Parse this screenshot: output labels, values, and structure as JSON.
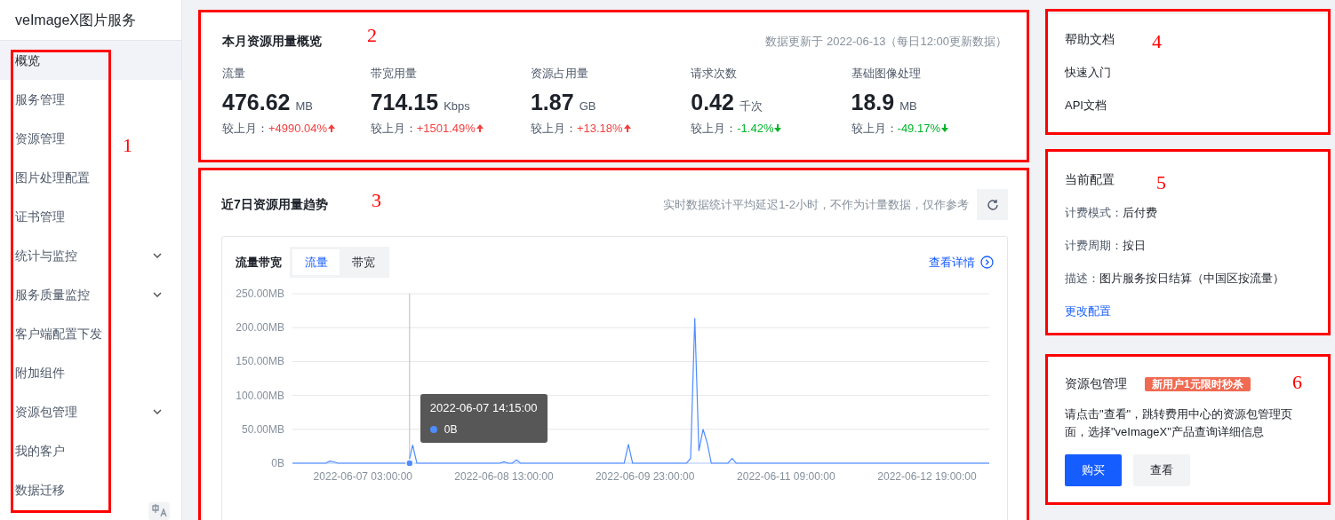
{
  "sidebar": {
    "title": "veImageX图片服务",
    "annotation": "1",
    "items": [
      {
        "label": "概览",
        "selected": true,
        "expandable": false
      },
      {
        "label": "服务管理",
        "selected": false,
        "expandable": false
      },
      {
        "label": "资源管理",
        "selected": false,
        "expandable": false
      },
      {
        "label": "图片处理配置",
        "selected": false,
        "expandable": false
      },
      {
        "label": "证书管理",
        "selected": false,
        "expandable": false
      },
      {
        "label": "统计与监控",
        "selected": false,
        "expandable": true
      },
      {
        "label": "服务质量监控",
        "selected": false,
        "expandable": true
      },
      {
        "label": "客户端配置下发",
        "selected": false,
        "expandable": false
      },
      {
        "label": "附加组件",
        "selected": false,
        "expandable": false
      },
      {
        "label": "资源包管理",
        "selected": false,
        "expandable": true
      },
      {
        "label": "我的客户",
        "selected": false,
        "expandable": false
      },
      {
        "label": "数据迁移",
        "selected": false,
        "expandable": false
      }
    ]
  },
  "overview": {
    "title": "本月资源用量概览",
    "annotation": "2",
    "update_note": "数据更新于 2022-06-13（每日12:00更新数据）",
    "metrics": [
      {
        "label": "流量",
        "value": "476.62",
        "unit": "MB",
        "change_label": "较上月：",
        "change": "+4990.04%",
        "increase": true
      },
      {
        "label": "带宽用量",
        "value": "714.15",
        "unit": "Kbps",
        "change_label": "较上月：",
        "change": "+1501.49%",
        "increase": true
      },
      {
        "label": "资源占用量",
        "value": "1.87",
        "unit": "GB",
        "change_label": "较上月：",
        "change": "+13.18%",
        "increase": true
      },
      {
        "label": "请求次数",
        "value": "0.42",
        "unit": "千次",
        "change_label": "较上月：",
        "change": "-1.42%",
        "increase": false
      },
      {
        "label": "基础图像处理",
        "value": "18.9",
        "unit": "MB",
        "change_label": "较上月：",
        "change": "-49.17%",
        "increase": false
      }
    ]
  },
  "trend": {
    "title": "近7日资源用量趋势",
    "annotation": "3",
    "note": "实时数据统计平均延迟1-2小时，不作为计量数据，仅作参考",
    "card": {
      "title": "流量带宽",
      "tabs": [
        {
          "label": "流量",
          "selected": true
        },
        {
          "label": "带宽",
          "selected": false
        }
      ],
      "link": "查看详情",
      "tooltip": {
        "time": "2022-06-07 14:15:00",
        "value": "0B"
      },
      "chart_data": {
        "type": "line",
        "grid": true,
        "ylim": [
          0,
          250
        ],
        "categories": [
          null,
          null,
          null,
          null,
          null,
          null,
          null,
          null,
          null,
          null,
          null,
          null,
          null,
          null,
          null,
          null,
          null,
          "2022-06-07 03:00:00",
          null,
          null,
          null,
          null,
          null,
          null,
          null,
          null,
          null,
          null,
          null,
          null,
          null,
          null,
          null,
          null,
          null,
          null,
          null,
          null,
          null,
          null,
          null,
          null,
          null,
          null,
          null,
          null,
          null,
          null,
          null,
          null,
          null,
          "2022-06-08 13:00:00",
          null,
          null,
          null,
          null,
          null,
          null,
          null,
          null,
          null,
          null,
          null,
          null,
          null,
          null,
          null,
          null,
          null,
          null,
          null,
          null,
          null,
          null,
          null,
          null,
          null,
          null,
          null,
          null,
          null,
          null,
          null,
          null,
          null,
          "2022-06-09 23:00:00",
          null,
          null,
          null,
          null,
          null,
          null,
          null,
          null,
          null,
          null,
          null,
          null,
          null,
          null,
          null,
          null,
          null,
          null,
          null,
          null,
          null,
          null,
          null,
          null,
          null,
          null,
          null,
          null,
          null,
          null,
          null,
          null,
          null,
          "2022-06-11 09:00:00",
          null,
          null,
          null,
          null,
          null,
          null,
          null,
          null,
          null,
          null,
          null,
          null,
          null,
          null,
          null,
          null,
          null,
          null,
          null,
          null,
          null,
          null,
          null,
          null,
          null,
          null,
          null,
          null,
          null,
          null,
          null,
          null,
          null,
          "2022-06-12 19:00:00",
          null,
          null,
          null,
          null,
          null,
          null,
          null,
          null,
          null,
          null,
          null,
          null,
          null,
          null,
          null
        ],
        "yticks": [
          {
            "value": 0,
            "label": "0B"
          },
          {
            "value": 50,
            "label": "50.00MB"
          },
          {
            "value": 100,
            "label": "100.00MB"
          },
          {
            "value": 150,
            "label": "150.00MB"
          },
          {
            "value": 200,
            "label": "200.00MB"
          },
          {
            "value": 250,
            "label": "250.00MB"
          }
        ],
        "series": [
          {
            "color": "#4e8cff",
            "values": [
              0,
              0,
              0,
              0,
              0,
              0,
              0,
              0,
              0,
              3,
              2,
              0,
              0,
              0,
              0,
              0,
              0,
              0,
              0,
              0,
              0,
              0,
              0,
              0,
              0,
              0,
              0,
              0,
              0,
              27,
              0,
              0,
              0,
              0,
              0,
              0,
              0,
              0,
              0,
              0,
              0,
              0,
              0,
              0,
              0,
              0,
              0,
              0,
              0,
              0,
              0,
              2,
              0,
              0,
              5,
              0,
              0,
              0,
              0,
              0,
              0,
              0,
              0,
              0,
              0,
              0,
              0,
              0,
              0,
              0,
              0,
              0,
              0,
              0,
              0,
              0,
              0,
              0,
              0,
              0,
              0,
              28,
              0,
              0,
              0,
              0,
              0,
              0,
              0,
              0,
              0,
              0,
              0,
              0,
              0,
              0,
              7,
              214,
              18,
              50,
              30,
              0,
              0,
              0,
              0,
              0,
              7,
              0,
              0,
              0,
              0,
              0,
              0,
              0,
              0,
              0,
              0,
              0,
              0,
              0,
              0,
              0,
              0,
              0,
              0,
              0,
              0,
              0,
              0,
              0,
              0,
              0,
              0,
              0,
              0,
              0,
              0,
              0,
              0,
              0,
              0,
              0,
              0,
              0,
              0,
              0,
              0,
              0,
              0,
              0,
              0,
              0,
              0,
              0,
              0,
              0,
              0,
              0,
              0,
              0,
              0,
              0,
              0,
              0,
              0,
              0,
              0,
              0,
              0
            ]
          }
        ]
      }
    }
  },
  "help": {
    "title": "帮助文档",
    "annotation": "4",
    "links": [
      "快速入门",
      "API文档"
    ]
  },
  "config": {
    "title": "当前配置",
    "annotation": "5",
    "rows": [
      {
        "label": "计费模式：",
        "value": "后付费"
      },
      {
        "label": "计费周期：",
        "value": "按日"
      },
      {
        "label": "描述：",
        "value": "图片服务按日结算（中国区按流量）"
      }
    ],
    "link": "更改配置"
  },
  "package": {
    "title": "资源包管理",
    "annotation": "6",
    "badge": "新用户1元限时秒杀",
    "description": "请点击\"查看\"，跳转费用中心的资源包管理页面，选择\"veImageX\"产品查询详细信息",
    "buttons": [
      {
        "label": "购买",
        "kind": "primary"
      },
      {
        "label": "查看",
        "kind": "secondary"
      }
    ]
  }
}
